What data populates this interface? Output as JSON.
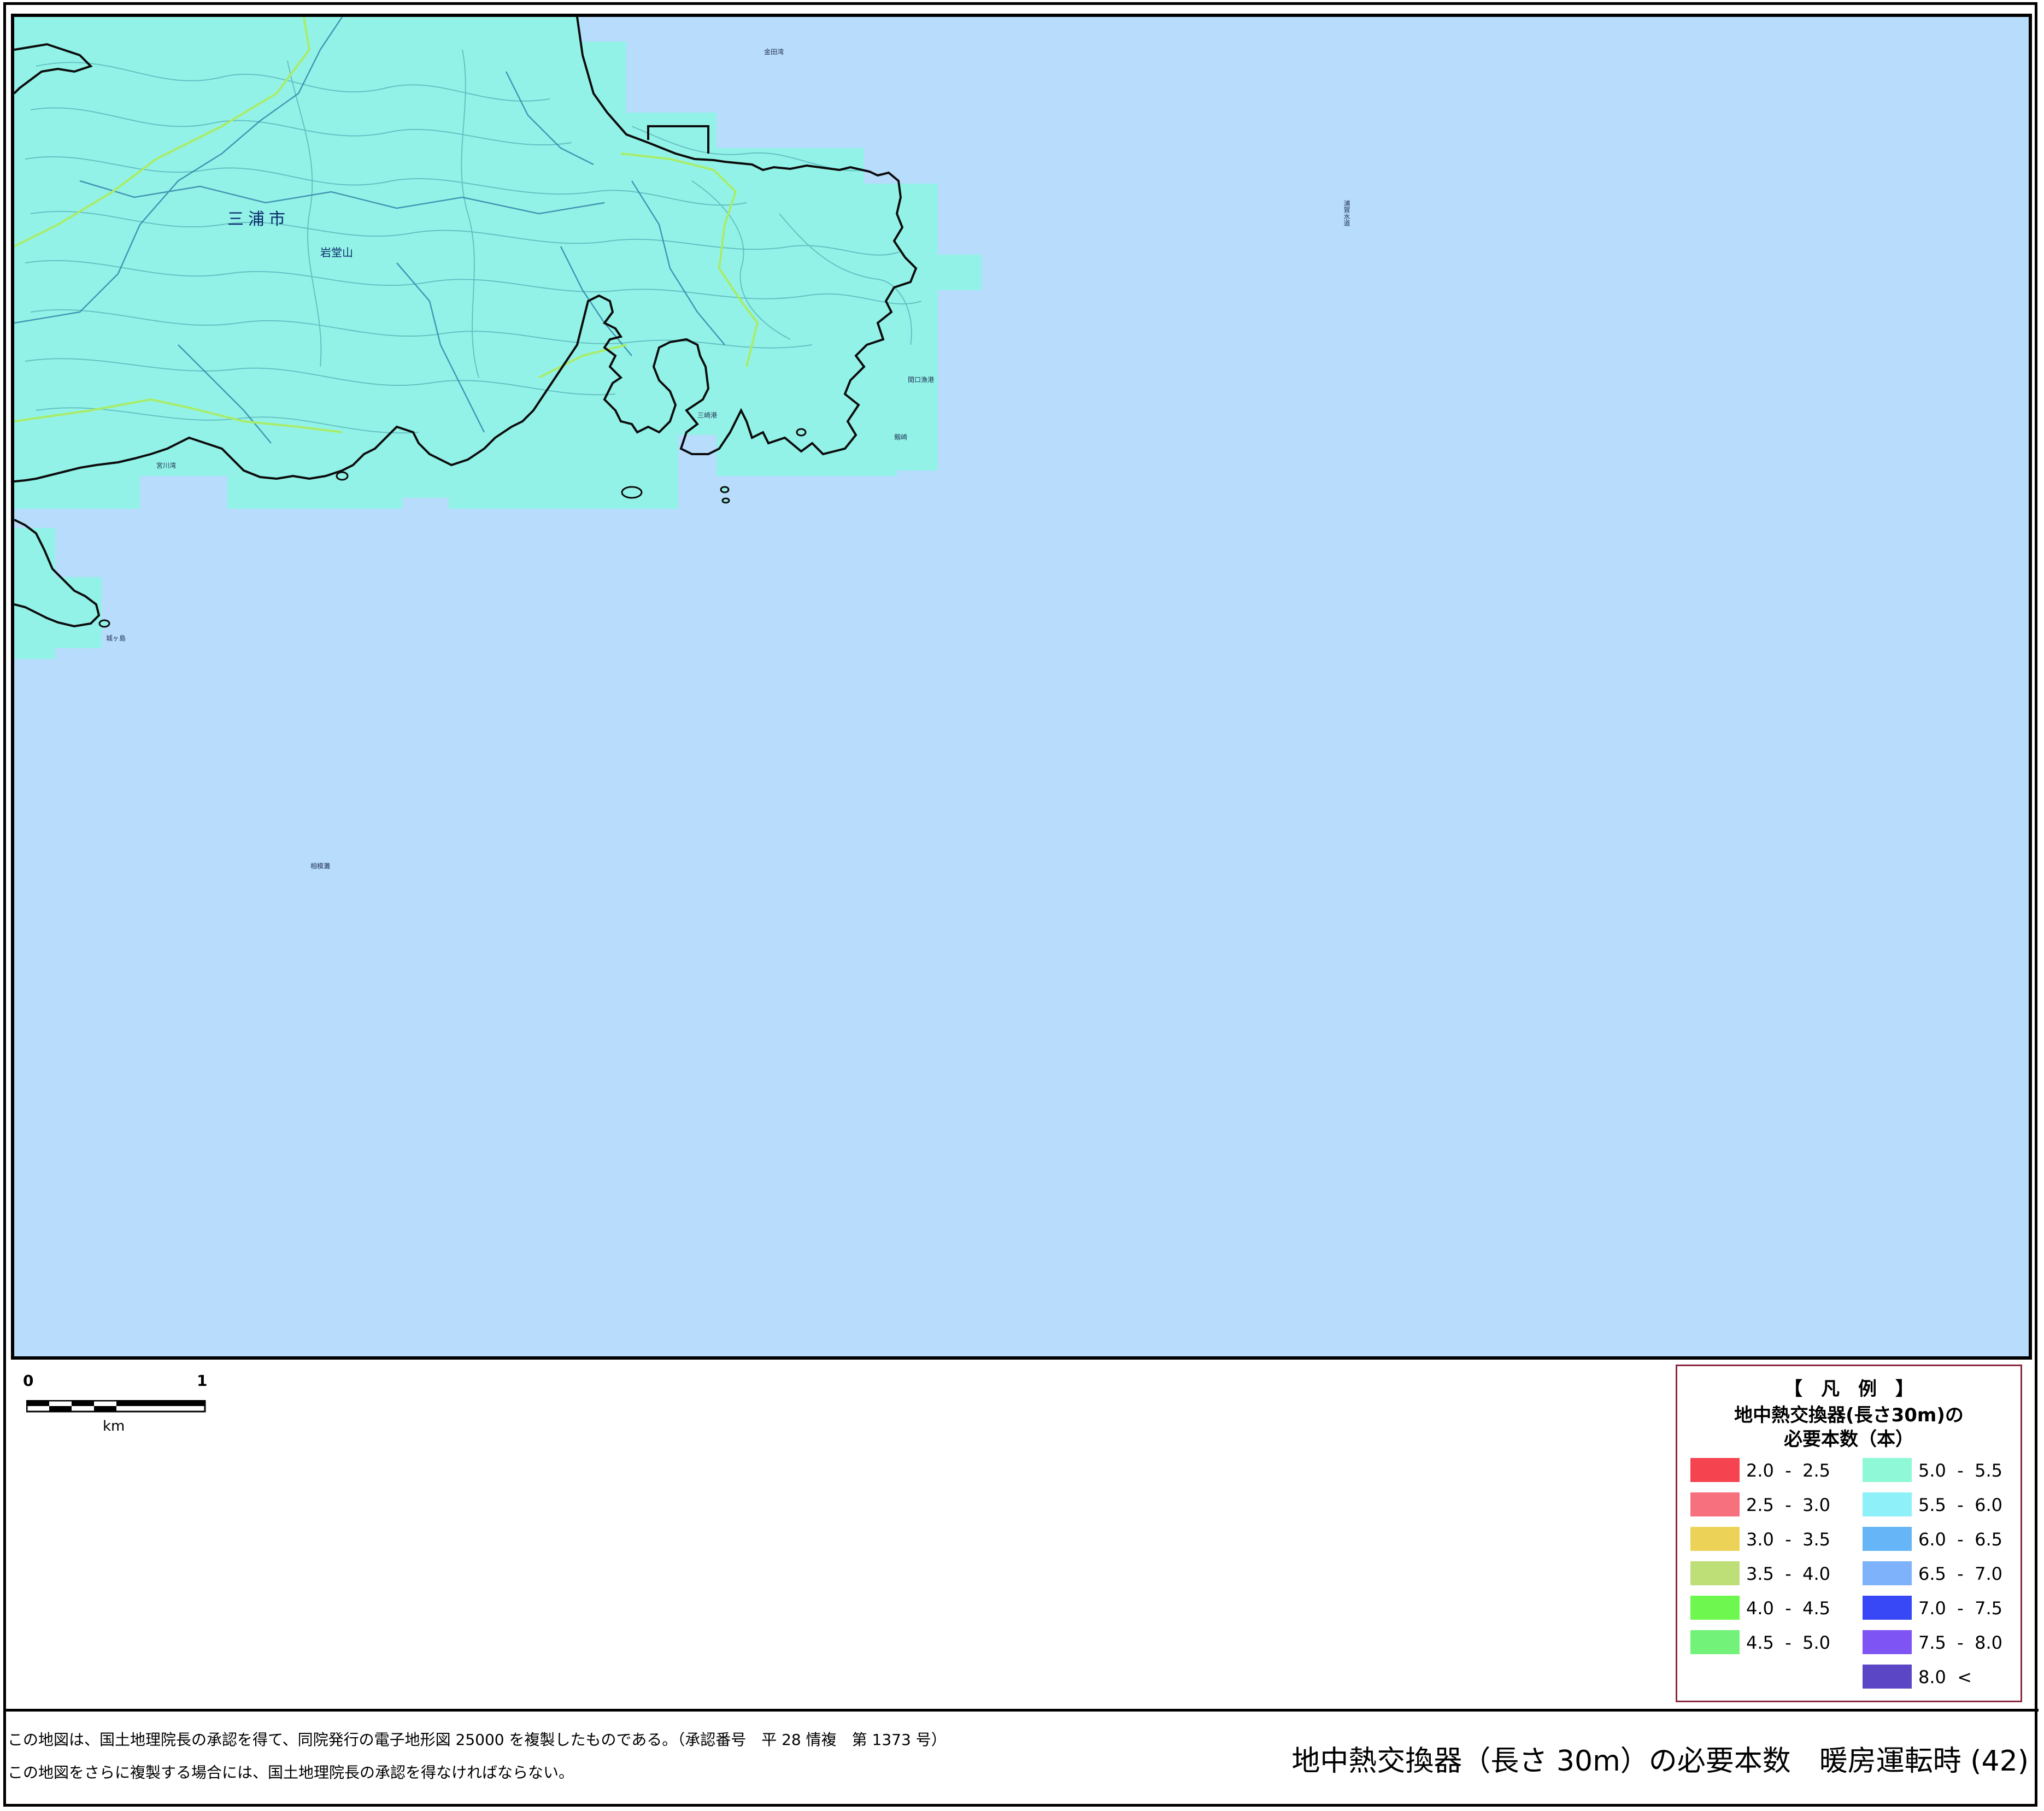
{
  "map": {
    "place_labels": {
      "city": "三浦市",
      "mountain": "岩堂山",
      "bay_top": "金田湾",
      "channel": "浦賀水道",
      "harbor": "間口漁港",
      "cape": "剱崎",
      "jogashima": "城ヶ島",
      "bay_west": "宮川湾",
      "shoal": "相模灘",
      "misaki": "三崎港"
    }
  },
  "scale_bar": {
    "start_label": "0",
    "end_label": "1",
    "unit_label": "km"
  },
  "legend": {
    "title": "【　凡　例　】",
    "subtitle_line1": "地中熱交換器(長さ30m)の",
    "subtitle_line2": "必要本数（本）",
    "items": [
      {
        "label": "2.0  -  2.5",
        "color": "#f5434f"
      },
      {
        "label": "2.5  -  3.0",
        "color": "#f6707e"
      },
      {
        "label": "3.0  -  3.5",
        "color": "#ecd357"
      },
      {
        "label": "3.5  -  4.0",
        "color": "#bede78"
      },
      {
        "label": "4.0  -  4.5",
        "color": "#6df74f"
      },
      {
        "label": "4.5  -  5.0",
        "color": "#73f27a"
      },
      {
        "label": "5.0  -  5.5",
        "color": "#8ff8d6"
      },
      {
        "label": "5.5  -  6.0",
        "color": "#8ef0f8"
      },
      {
        "label": "6.0  -  6.5",
        "color": "#65b5f7"
      },
      {
        "label": "6.5  -  7.0",
        "color": "#7eb2fb"
      },
      {
        "label": "7.0  -  7.5",
        "color": "#3848f6"
      },
      {
        "label": "7.5  -  8.0",
        "color": "#7e55f4"
      },
      {
        "label": "8.0  <",
        "color": "#5b46c5"
      }
    ]
  },
  "colors": {
    "sea": "#b8dcfb",
    "land": "#93f2e8",
    "coast": "#0c0c0c",
    "contour": "#3f9aa5",
    "boundary": "#a8ec6a"
  },
  "footer": {
    "note_line1": "この地図は、国土地理院長の承認を得て、同院発行の電子地形図 25000 を複製したものである。（承認番号　平 28 情複　第 1373 号）",
    "note_line2": "この地図をさらに複製する場合には、国土地理院長の承認を得なければならない。",
    "title": "地中熱交換器（長さ 30m）の必要本数　暖房運転時 (42)"
  }
}
